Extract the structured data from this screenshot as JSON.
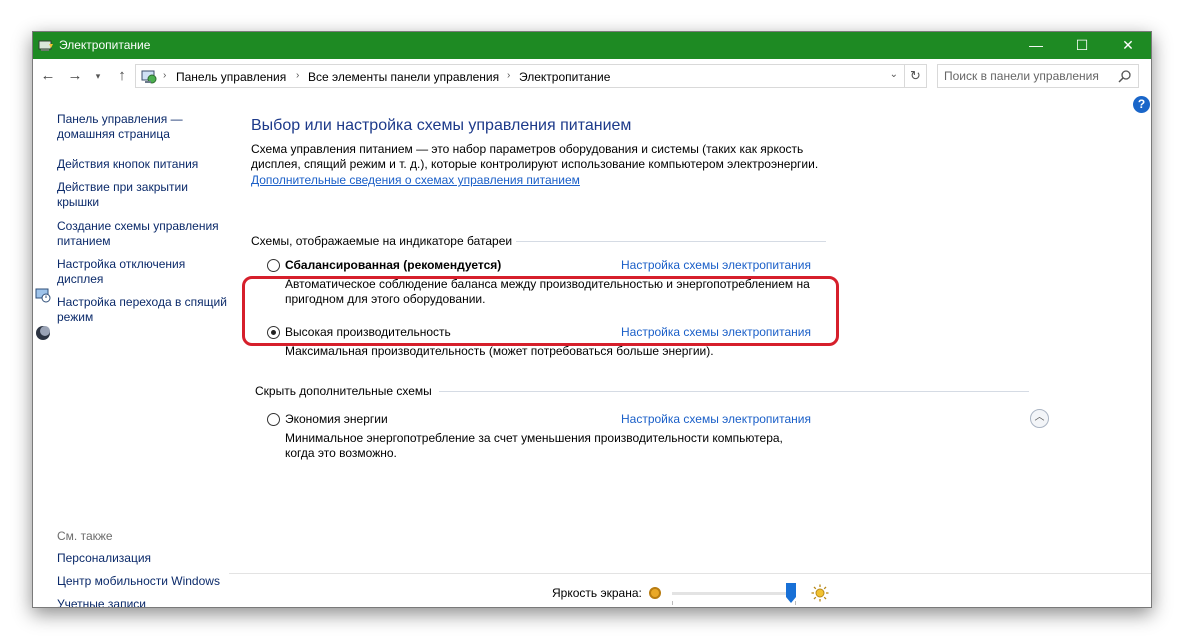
{
  "window": {
    "title": "Электропитание",
    "accent_color": "#1e8a23",
    "controls": {
      "minimize": "—",
      "maximize": "☐",
      "close": "✕"
    }
  },
  "address_bar": {
    "back": "←",
    "forward": "→",
    "up": "↑",
    "breadcrumb": [
      "Панель управления",
      "Все элементы панели управления",
      "Электропитание"
    ],
    "search_placeholder": "Поиск в панели управления"
  },
  "sidebar": {
    "items": [
      {
        "label": "Панель управления — домашняя страница"
      },
      {
        "label": "Действия кнопок питания"
      },
      {
        "label": "Действие при закрытии крышки"
      },
      {
        "label": "Создание схемы управления питанием"
      },
      {
        "label": "Настройка отключения дисплея"
      },
      {
        "label": "Настройка перехода в спящий режим"
      }
    ],
    "see_also_label": "См. также",
    "see_also": [
      {
        "label": "Персонализация"
      },
      {
        "label": "Центр мобильности Windows"
      },
      {
        "label": "Учетные записи пользователей"
      }
    ]
  },
  "main": {
    "heading": "Выбор или настройка схемы управления питанием",
    "description": "Схема управления питанием — это набор параметров оборудования и системы (таких как яркость дисплея, спящий режим и т. д.), которые контролируют использование компьютером электроэнергии.",
    "more_link": "Дополнительные сведения о схемах управления питанием",
    "battery_group_label": "Схемы, отображаемые на индикаторе батареи",
    "hidden_group_label": "Скрыть дополнительные схемы",
    "plans": [
      {
        "name": "Сбалансированная (рекомендуется)",
        "link": "Настройка схемы электропитания",
        "description": "Автоматическое соблюдение баланса между производительностью и энергопотреблением на пригодном для этого оборудовании.",
        "selected": false
      },
      {
        "name": "Высокая производительность",
        "link": "Настройка схемы электропитания",
        "description": "Максимальная производительность (может потребоваться больше энергии).",
        "selected": true
      },
      {
        "name": "Экономия энергии",
        "link": "Настройка схемы электропитания",
        "description": "Минимальное энергопотребление за счет уменьшения производительности компьютера, когда это возможно.",
        "selected": false
      }
    ]
  },
  "brightness": {
    "label": "Яркость экрана:",
    "level": 1.0
  }
}
